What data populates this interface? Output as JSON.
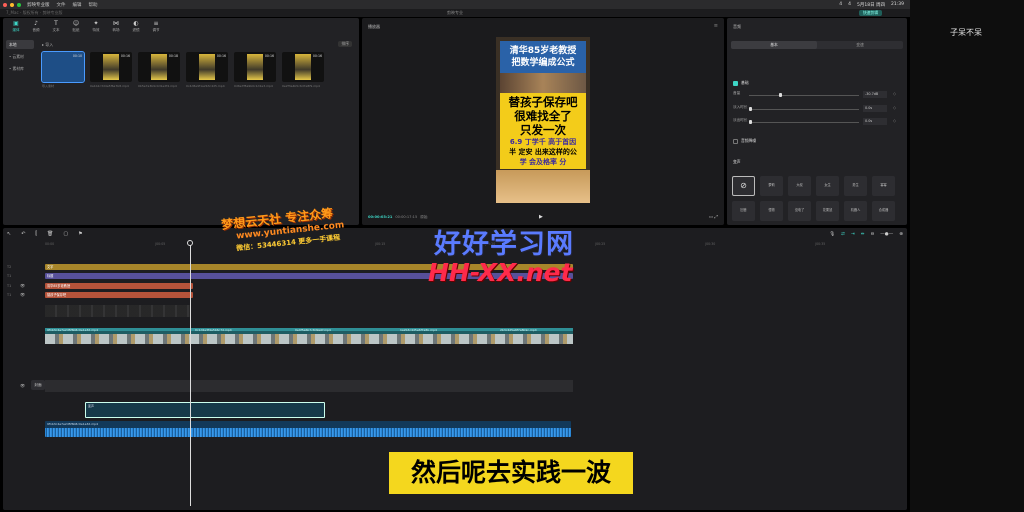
{
  "menubar": {
    "app_name": "剪映专业版",
    "items": [
      "文件",
      "编辑",
      "帮助"
    ],
    "right": [
      "4",
      "4",
      "5月18日 周四",
      "21:39"
    ]
  },
  "titlebar": {
    "left": "7_Mac - 版权所有 · 剪映专业版",
    "title": "剪映专业",
    "badge": "快速剪辑"
  },
  "sidepanel": {
    "user_name": "子呆不呆"
  },
  "media": {
    "tools": [
      "媒体",
      "音频",
      "文本",
      "贴纸",
      "特效",
      "转场",
      "滤镜",
      "调节"
    ],
    "nav": [
      "本地",
      "• 云素材",
      "• 素材库"
    ],
    "import_label": "导入",
    "sort_label": "排序",
    "thumbs": [
      {
        "dur": "00:10",
        "label": "导入素材"
      },
      {
        "dur": "00:16",
        "label": "0a1b2c3d4e5f6a7b8.mp4"
      },
      {
        "dur": "00:18",
        "label": "0b5e7a3b9c0d1e2f4.mp4"
      },
      {
        "dur": "00:16",
        "label": "0c4d8e9f1a2b3c4d5.mp4"
      },
      {
        "dur": "00:16",
        "label": "0d6e7f8a9b0c1d2e3.mp4"
      },
      {
        "dur": "00:16",
        "label": "0e2f3a4b5c6d7e8f9.mp4"
      }
    ]
  },
  "preview": {
    "title": "播放器",
    "video_lines_blue": [
      "清华85岁老教授",
      "把数学编成公式"
    ],
    "video_lines_yellow": [
      "替孩子保存吧",
      "很难找全了",
      "只发一次"
    ],
    "video_lines_small": [
      "6.9 丁学千 高于首因",
      "半 定安 出来这样的公",
      "学 会及格率 分"
    ],
    "time_current": "00:00:03:21",
    "time_total": "00:00:17:15",
    "ratio_label": "原始"
  },
  "props": {
    "title": "音频",
    "tabs": [
      "基本",
      "变速"
    ],
    "basic_label": "基础",
    "rows": [
      {
        "label": "音量",
        "value": "-30.7dB",
        "fill": 0.27
      },
      {
        "label": "淡入时长",
        "value": "0.0s",
        "fill": 0
      },
      {
        "label": "淡出时长",
        "value": "0.0s",
        "fill": 0
      }
    ],
    "denoise_label": "音频降噪",
    "voice_label": "变声",
    "voices_row1": [
      "无",
      "萝莉",
      "大叔",
      "女生",
      "男生",
      "幂幂"
    ],
    "voices_row2": [
      "回音",
      "怪物",
      "没电了",
      "花栗鼠",
      "机器人",
      "合成器"
    ]
  },
  "timeline": {
    "ruler": [
      "00:00",
      "|00:05",
      "|00:10",
      "|00:15",
      "|00:20",
      "|00:25",
      "|00:30",
      "|00:35"
    ],
    "tracks": [
      {
        "label": "T2",
        "clip": "文字",
        "class": "c-gold"
      },
      {
        "label": "T1",
        "clip": "标题",
        "class": "c-purple"
      },
      {
        "label": "T1",
        "clip": "清华85岁老教授",
        "class": "c-red"
      },
      {
        "label": "T1",
        "clip": "替孩子保存吧",
        "class": "c-red"
      }
    ],
    "main_video_label": "9f1b3c4e7a2d5f6b8c0e1a3d.mp4",
    "main_video_segments": [
      "0c1d2e3f4a5b6c7d.mp4",
      "0e4f5a6b7c8d9e0f.mp4",
      "1a2b3c4d5e6f7a8b.mp4",
      "2b3c4d5e6f7a8b9c.mp4"
    ],
    "cover_label": "封面",
    "audio1_label": "变声",
    "audio2_label": "9f1b3c4e7a2d5f6b8c0e1a3d.mp4"
  },
  "watermarks": {
    "w1": "梦想云天社 专注众筹",
    "w2": "www.yuntianshe.com",
    "w3": "微信：53446314 更多一手课程",
    "w4": "好好学习网",
    "w5": "HH-XX.net"
  },
  "subtitle": "然后呢去实践一波"
}
